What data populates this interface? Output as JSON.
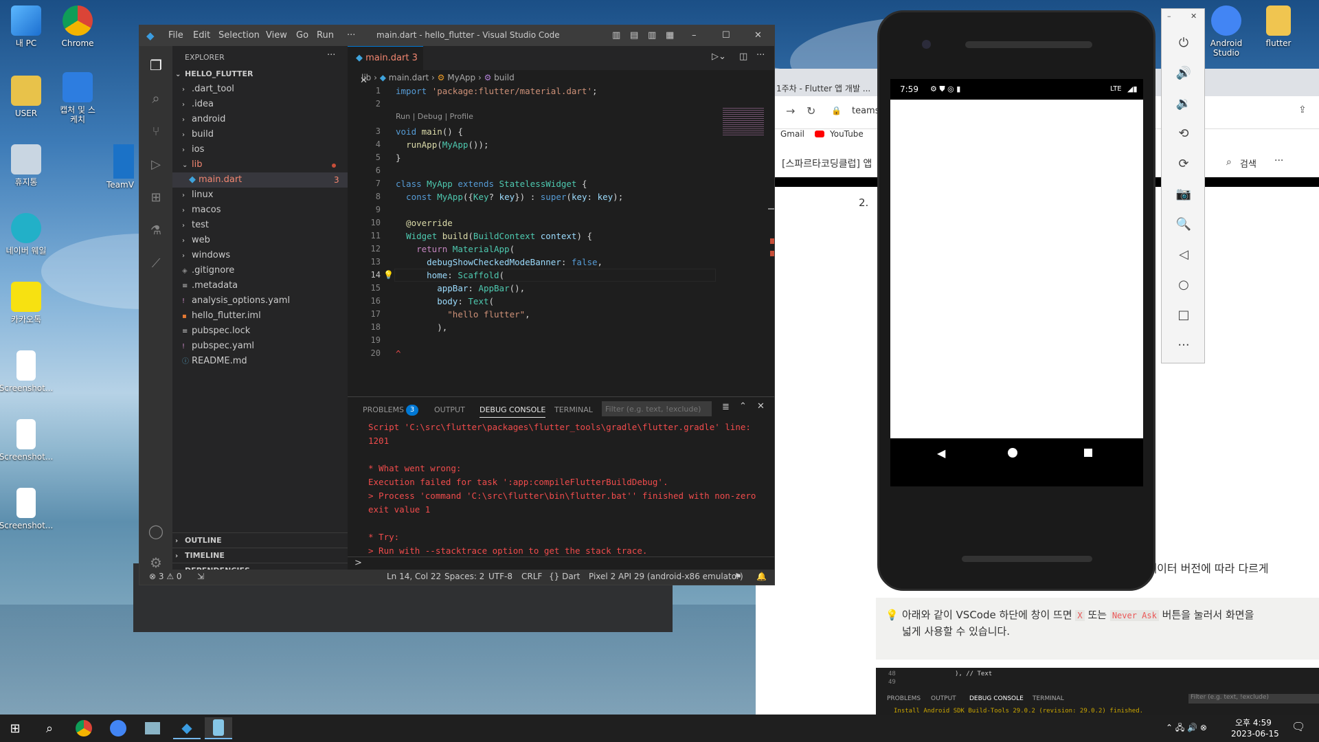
{
  "desktop": {
    "icons": [
      {
        "label": "내 PC"
      },
      {
        "label": "Chrome"
      },
      {
        "label": "USER"
      },
      {
        "label": "캡처 및 스케치"
      },
      {
        "label": "휴지통"
      },
      {
        "label": "네이버 웨일"
      },
      {
        "label": "카카오톡"
      },
      {
        "label": "Screenshot..."
      },
      {
        "label": "Screenshot..."
      },
      {
        "label": "Screenshot..."
      },
      {
        "label": "Android Studio"
      },
      {
        "label": "flutter"
      }
    ],
    "teamviewer_label": "TeamV"
  },
  "vscode": {
    "title": "main.dart - hello_flutter - Visual Studio Code",
    "menu": [
      "File",
      "Edit",
      "Selection",
      "View",
      "Go",
      "Run",
      "···"
    ],
    "explorer_title": "EXPLORER",
    "explorer_more": "···",
    "project": "HELLO_FLUTTER",
    "tree": [
      ".dart_tool",
      ".idea",
      "android",
      "build",
      "ios",
      "lib",
      "main.dart",
      "linux",
      "macos",
      "test",
      "web",
      "windows",
      ".gitignore",
      ".metadata",
      "analysis_options.yaml",
      "hello_flutter.iml",
      "pubspec.lock",
      "pubspec.yaml",
      "README.md"
    ],
    "main_badge": "3",
    "bottom_sections": [
      "OUTLINE",
      "TIMELINE",
      "DEPENDENCIES"
    ],
    "tab": {
      "label": "main.dart",
      "badge": "3",
      "close": "✕"
    },
    "breadcrumb": {
      "a": "lib",
      "b": "main.dart",
      "c": "MyApp",
      "d": "build"
    },
    "codelens": "Run | Debug | Profile",
    "lines": [
      "1",
      "2",
      "3",
      "4",
      "5",
      "6",
      "7",
      "8",
      "9",
      "10",
      "11",
      "12",
      "13",
      "14",
      "15",
      "16",
      "17",
      "18",
      "19",
      "20"
    ],
    "code": {
      "l1a": "import ",
      "l1b": "'package:flutter/material.dart'",
      "l1c": ";",
      "l3a": "void ",
      "l3b": "main",
      "l3c": "() {",
      "l4a": "  ",
      "l4b": "runApp",
      "l4c": "(",
      "l4d": "MyApp",
      "l4e": "());",
      "l5": "}",
      "l7a": "class ",
      "l7b": "MyApp",
      "l7c": " extends ",
      "l7d": "StatelessWidget",
      "l7e": " {",
      "l8a": "  const ",
      "l8b": "MyApp",
      "l8c": "({",
      "l8d": "Key",
      "l8e": "? ",
      "l8f": "key",
      "l8g": "}) : ",
      "l8h": "super",
      "l8i": "(",
      "l8j": "key",
      "l8k": ": ",
      "l8l": "key",
      "l8m": ");",
      "l10": "  @override",
      "l11a": "  ",
      "l11b": "Widget",
      "l11c": " ",
      "l11d": "build",
      "l11e": "(",
      "l11f": "BuildContext",
      "l11g": " ",
      "l11h": "context",
      "l11i": ") {",
      "l12a": "    return ",
      "l12b": "MaterialApp",
      "l12c": "(",
      "l13a": "      ",
      "l13b": "debugShowCheckedModeBanner",
      "l13c": ": ",
      "l13d": "false",
      "l13e": ",",
      "l14a": "      ",
      "l14b": "home",
      "l14c": ": ",
      "l14d": "Scaffold",
      "l14e": "(",
      "l15a": "        ",
      "l15b": "appBar",
      "l15c": ": ",
      "l15d": "AppBar",
      "l15e": "(),",
      "l16a": "        ",
      "l16b": "body",
      "l16c": ": ",
      "l16d": "Text",
      "l16e": "(",
      "l17a": "          ",
      "l17b": "\"hello flutter\"",
      "l17c": ",",
      "l18": "        ),",
      "l20": "^"
    },
    "panel": {
      "tabs": [
        "PROBLEMS",
        "OUTPUT",
        "DEBUG CONSOLE",
        "TERMINAL"
      ],
      "problems_badge": "3",
      "filter_placeholder": "Filter (e.g. text, !exclude)",
      "output": [
        "Script 'C:\\src\\flutter\\packages\\flutter_tools\\gradle\\flutter.gradle' line:",
        "1201",
        "",
        "* What went wrong:",
        "Execution failed for task ':app:compileFlutterBuildDebug'.",
        "> Process 'command 'C:\\src\\flutter\\bin\\flutter.bat'' finished with non-zero",
        "exit value 1",
        "",
        "* Try:",
        "> Run with --stacktrace option to get the stack trace."
      ],
      "prompt": ">"
    },
    "status": {
      "errors": "⊗ 3 ⚠ 0",
      "pos": "Ln 14, Col 22",
      "spaces": "Spaces: 2",
      "enc": "UTF-8",
      "eol": "CRLF",
      "lang": "{} Dart",
      "device": "Pixel 2 API 29 (android-x86 emulator)"
    }
  },
  "browser": {
    "tab_title": "1주차 - Flutter 앱 개발 ...",
    "url": "teams",
    "bookmarks": [
      "Gmail",
      "YouTube"
    ],
    "page_title": "[스파르타코딩클럽] 앱",
    "search": "검색",
    "more": "···",
    "list_num": "2.",
    "para1": "에뮬레이터 버전에 따라 다르게",
    "tip": "아래와 같이 VSCode 하단에 창이 뜨면",
    "tip_x": "X",
    "tip_or": "또는",
    "tip_never": "Never Ask",
    "tip_rest": "버튼을 눌러서 화면을",
    "tip_line2": "넓게 사용할 수 있습니다.",
    "mini": {
      "l48": "48",
      "l49": "49",
      "code48": "), // Text",
      "tabs": [
        "PROBLEMS",
        "OUTPUT",
        "DEBUG CONSOLE",
        "TERMINAL"
      ],
      "filter": "Filter (e.g. text, !exclude)",
      "install": "Install Android SDK Build-Tools 29.0.2 (revision: 29.0.2) finished."
    }
  },
  "emulator": {
    "time": "7:59",
    "lte": "LTE"
  },
  "taskbar": {
    "time": "오후 4:59",
    "date": "2023-06-15"
  }
}
